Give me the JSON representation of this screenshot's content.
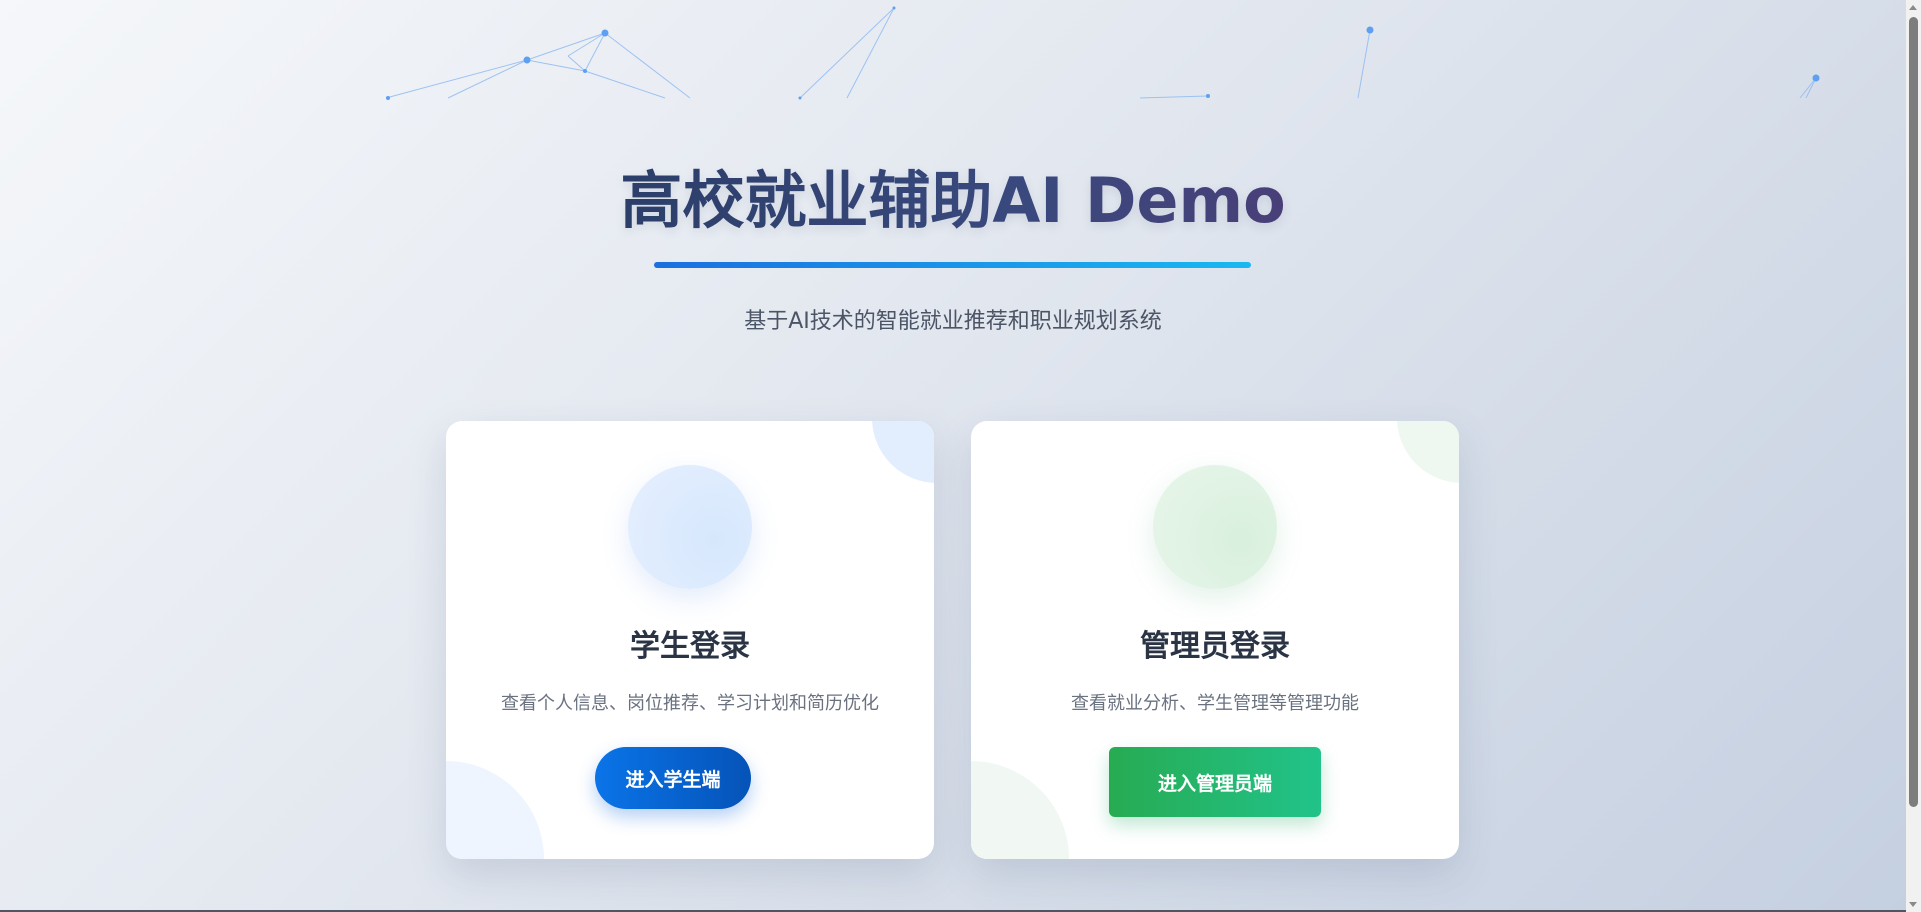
{
  "header": {
    "title": "高校就业辅助AI Demo",
    "subtitle": "基于AI技术的智能就业推荐和职业规划系统"
  },
  "cards": {
    "student": {
      "icon": "student-icon",
      "title": "学生登录",
      "description": "查看个人信息、岗位推荐、学习计划和简历优化",
      "button_label": "进入学生端",
      "accent_color": "#0a74e8"
    },
    "admin": {
      "icon": "admin-icon",
      "title": "管理员登录",
      "description": "查看就业分析、学生管理等管理功能",
      "button_label": "进入管理员端",
      "accent_color": "#27ab52"
    }
  },
  "colors": {
    "title_underline": "#1b6fe0",
    "network_lines": "#7aaef0"
  }
}
